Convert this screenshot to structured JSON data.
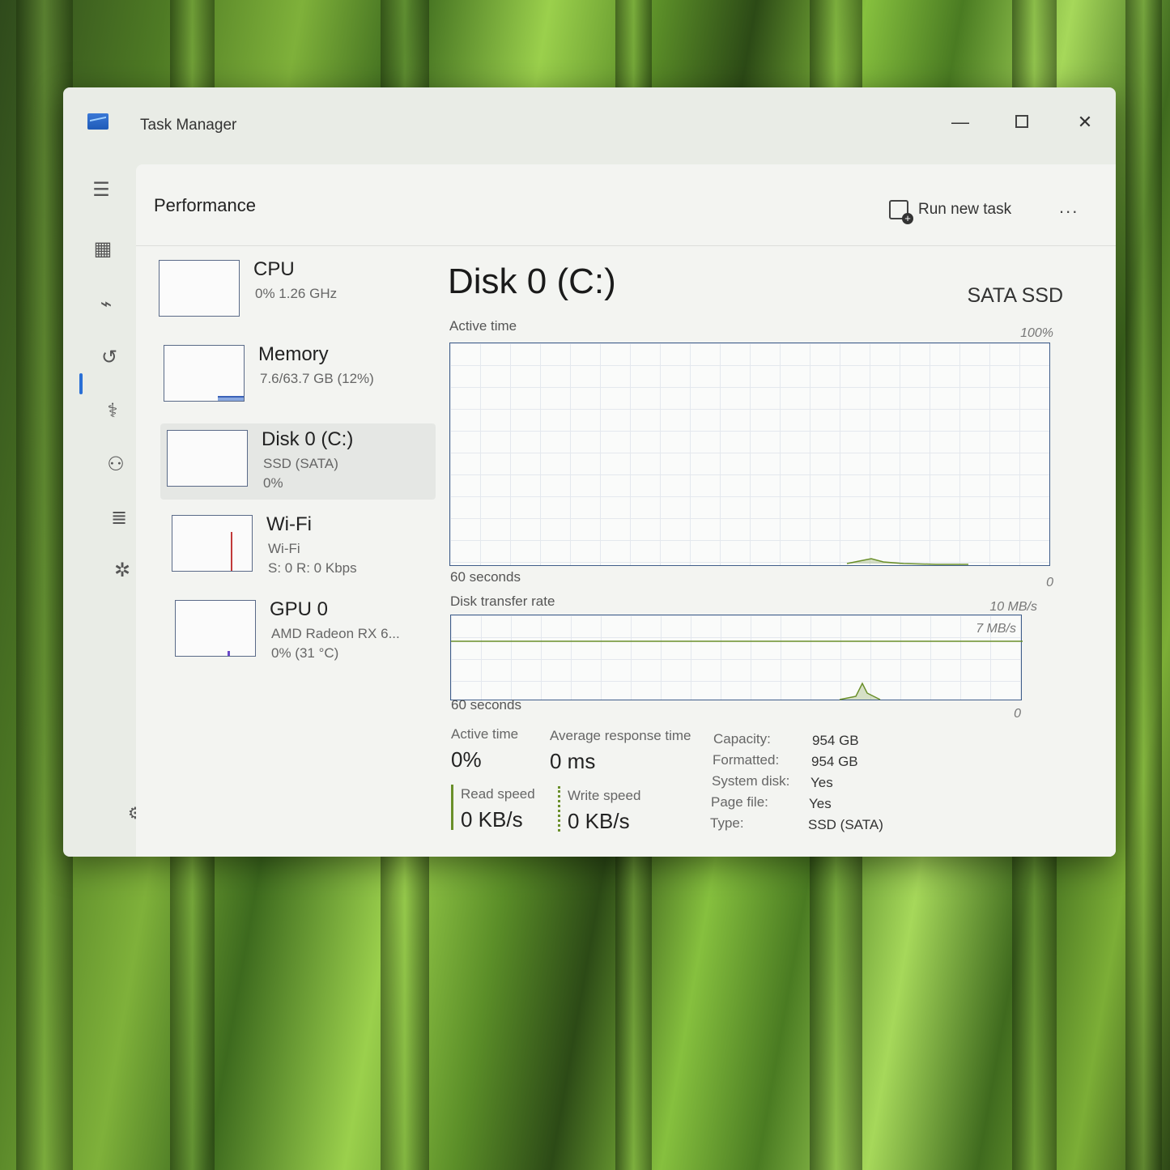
{
  "window": {
    "title": "Task Manager"
  },
  "nav": {
    "items": [
      {
        "name": "menu-icon",
        "glyph": "☰"
      },
      {
        "name": "processes-icon",
        "glyph": "▦"
      },
      {
        "name": "performance-icon",
        "glyph": "⌁"
      },
      {
        "name": "app-history-icon",
        "glyph": "↺"
      },
      {
        "name": "startup-apps-icon",
        "glyph": "⚕"
      },
      {
        "name": "users-icon",
        "glyph": "⚇"
      },
      {
        "name": "details-icon",
        "glyph": "≣"
      },
      {
        "name": "services-icon",
        "glyph": "✲"
      },
      {
        "name": "settings-icon",
        "glyph": "⚙"
      }
    ]
  },
  "header": {
    "page_title": "Performance",
    "run_new_task": "Run new task",
    "more": "..."
  },
  "devices": [
    {
      "name": "CPU",
      "line1": "0%  1.26 GHz",
      "line2": ""
    },
    {
      "name": "Memory",
      "line1": "7.6/63.7 GB (12%)",
      "line2": ""
    },
    {
      "name": "Disk 0 (C:)",
      "line1": "SSD (SATA)",
      "line2": "0%"
    },
    {
      "name": "Wi-Fi",
      "line1": "Wi-Fi",
      "line2": "S: 0 R: 0 Kbps"
    },
    {
      "name": "GPU 0",
      "line1": "AMD Radeon RX 6...",
      "line2": "0% (31 °C)"
    }
  ],
  "detail": {
    "title": "Disk 0 (C:)",
    "type": "SATA SSD",
    "active_graph": {
      "label": "Active time",
      "max": "100%",
      "min": "0",
      "span": "60 seconds"
    },
    "transfer_graph": {
      "label": "Disk transfer rate",
      "max": "10 MB/s",
      "line": "7 MB/s",
      "min": "0",
      "span": "60 seconds"
    },
    "stats": {
      "active_time_label": "Active time",
      "active_time_value": "0%",
      "avg_response_label": "Average response time",
      "avg_response_value": "0 ms",
      "read_speed_label": "Read speed",
      "read_speed_value": "0 KB/s",
      "write_speed_label": "Write speed",
      "write_speed_value": "0 KB/s"
    },
    "properties": [
      {
        "key": "Capacity:",
        "value": "954 GB"
      },
      {
        "key": "Formatted:",
        "value": "954 GB"
      },
      {
        "key": "System disk:",
        "value": "Yes"
      },
      {
        "key": "Page file:",
        "value": "Yes"
      },
      {
        "key": "Type:",
        "value": "SSD (SATA)"
      }
    ]
  },
  "colors": {
    "graph_border": "#3f5d8a",
    "disk_line": "#6a8f2a",
    "accent": "#2a6fd6"
  }
}
